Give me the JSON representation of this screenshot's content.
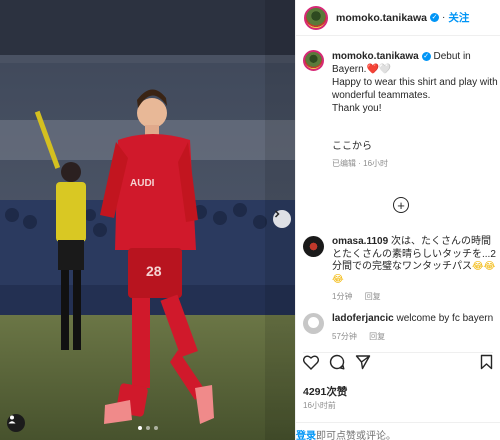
{
  "post": {
    "username": "momoko.tanikawa",
    "follow_label": "关注",
    "caption_line1": "Debut in",
    "caption_line2": "Bayern.",
    "caption_rest": "Happy to wear this shirt and play with wonderful teammates.",
    "caption_thanks": "Thank you!",
    "caption_extra": "ここから",
    "caption_edited": "已编辑",
    "caption_time": "16小时",
    "heart_red": "❤️",
    "heart_white": "🤍"
  },
  "comments": [
    {
      "username": "omasa.1109",
      "text": "次は、たくさんの時間とたくさんの素晴らしいタッチを...2分間での完璧なワンタッチパス",
      "emojis": "😂😂😂",
      "time": "1分钟",
      "reply_label": "回复"
    },
    {
      "username": "ladoferjancic",
      "text": "welcome by fc bayern",
      "time": "57分钟",
      "reply_label": "回复"
    }
  ],
  "footer": {
    "likes": "4291次赞",
    "time_ago": "16小时前",
    "login_link": "登录",
    "login_rest": "即可点赞或评论。"
  },
  "photo": {
    "jersey_text": "AUDI",
    "number": "28",
    "carousel_total": 3,
    "carousel_active": 1
  },
  "colors": {
    "accent": "#0095f6",
    "jersey": "#d0192b",
    "pitch": "#5c6a3e"
  },
  "icons": [
    "verified-icon",
    "more-comments-icon",
    "like-icon",
    "comment-icon",
    "share-icon",
    "save-icon",
    "next-photo-icon",
    "user-tag-icon"
  ]
}
